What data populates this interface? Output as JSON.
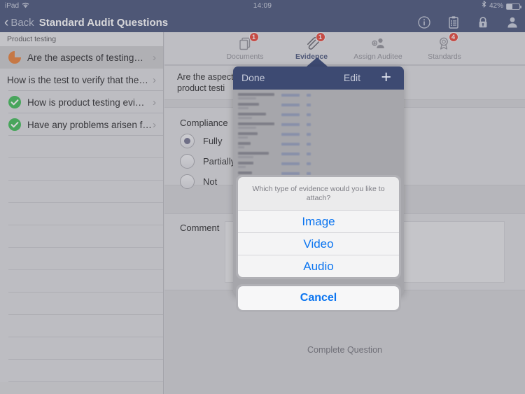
{
  "statusbar": {
    "device": "iPad",
    "wifi_icon": "wifi-icon",
    "time": "14:09",
    "bluetooth_icon": "bluetooth-icon",
    "battery_percent": "42%",
    "battery_level": 42
  },
  "navbar": {
    "back_chevron": "‹",
    "back_label": "Back",
    "title": "Standard Audit Questions",
    "icons": [
      {
        "name": "info-icon",
        "label": "Info"
      },
      {
        "name": "clipboard-icon",
        "label": "Audit list"
      },
      {
        "name": "lock-icon",
        "label": "Lock"
      },
      {
        "name": "user-icon",
        "label": "User"
      }
    ]
  },
  "sidebar": {
    "section_header": "Product testing",
    "chevron": "›",
    "items": [
      {
        "label": "Are the aspects of  testing…",
        "status": "partial",
        "selected": true
      },
      {
        "label": "How is the test to verify that the…",
        "status": "none",
        "selected": false
      },
      {
        "label": "How is product testing evi…",
        "status": "complete",
        "selected": false
      },
      {
        "label": "Have any problems arisen f…",
        "status": "complete",
        "selected": false
      }
    ],
    "empty_rows": 11
  },
  "tabs": [
    {
      "label": "Documents",
      "icon": "documents-icon",
      "badge": "1",
      "active": false
    },
    {
      "label": "Evidence",
      "icon": "paperclip-icon",
      "badge": "1",
      "active": true
    },
    {
      "label": "Assign Auditee",
      "icon": "add-person-icon",
      "badge": "",
      "active": false
    },
    {
      "label": "Standards",
      "icon": "award-icon",
      "badge": "4",
      "active": false
    }
  ],
  "question": {
    "text_line1": "Are the aspects of                                                       e product covered in the",
    "text_line2": "product testi"
  },
  "compliance": {
    "label": "Compliance",
    "options": [
      {
        "label": "Fully",
        "short": "F",
        "selected": true
      },
      {
        "label": "Partially",
        "short": "P",
        "selected": false
      },
      {
        "label": "Not",
        "short": "N",
        "selected": false
      }
    ]
  },
  "comment": {
    "label": "Comment",
    "value": "",
    "placeholder": ""
  },
  "footer": {
    "complete_question": "Complete Question"
  },
  "popover": {
    "done_label": "Done",
    "edit_label": "Edit",
    "add_label": "+"
  },
  "action_sheet": {
    "title": "Which type of evidence would you like to attach?",
    "options": [
      "Image",
      "Video",
      "Audio"
    ],
    "cancel": "Cancel"
  },
  "colors": {
    "nav_blue": "#3d4a72",
    "accent_blue": "#0a74f0",
    "badge_red": "#e8392b",
    "status_green": "#34b94c",
    "status_orange": "#e8792c"
  }
}
